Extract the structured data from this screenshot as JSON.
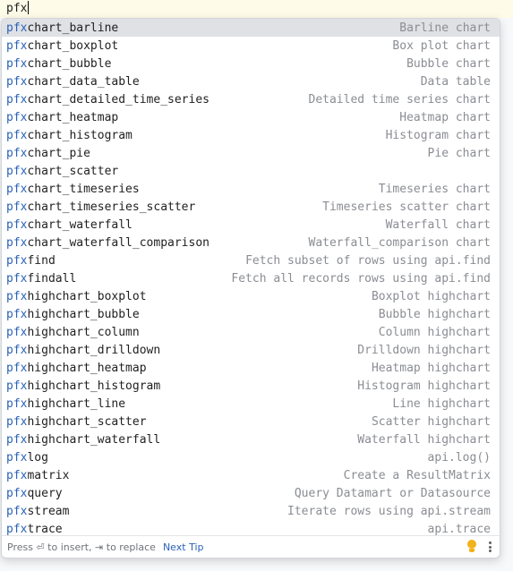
{
  "editor": {
    "typed_text": "pfx"
  },
  "completion": {
    "prefix": "pfx",
    "items": [
      {
        "name": "chart_barline",
        "desc": "Barline chart"
      },
      {
        "name": "chart_boxplot",
        "desc": "Box plot chart"
      },
      {
        "name": "chart_bubble",
        "desc": "Bubble chart"
      },
      {
        "name": "chart_data_table",
        "desc": "Data table"
      },
      {
        "name": "chart_detailed_time_series",
        "desc": "Detailed time series chart"
      },
      {
        "name": "chart_heatmap",
        "desc": "Heatmap chart"
      },
      {
        "name": "chart_histogram",
        "desc": "Histogram chart"
      },
      {
        "name": "chart_pie",
        "desc": "Pie chart"
      },
      {
        "name": "chart_scatter",
        "desc": ""
      },
      {
        "name": "chart_timeseries",
        "desc": "Timeseries chart"
      },
      {
        "name": "chart_timeseries_scatter",
        "desc": "Timeseries scatter chart"
      },
      {
        "name": "chart_waterfall",
        "desc": "Waterfall chart"
      },
      {
        "name": "chart_waterfall_comparison",
        "desc": "Waterfall_comparison chart"
      },
      {
        "name": "find",
        "desc": "Fetch subset of rows using api.find"
      },
      {
        "name": "findall",
        "desc": "Fetch all records rows using api.find"
      },
      {
        "name": "highchart_boxplot",
        "desc": "Boxplot highchart"
      },
      {
        "name": "highchart_bubble",
        "desc": "Bubble highchart"
      },
      {
        "name": "highchart_column",
        "desc": "Column highchart"
      },
      {
        "name": "highchart_drilldown",
        "desc": "Drilldown highchart"
      },
      {
        "name": "highchart_heatmap",
        "desc": "Heatmap highchart"
      },
      {
        "name": "highchart_histogram",
        "desc": "Histogram highchart"
      },
      {
        "name": "highchart_line",
        "desc": "Line highchart"
      },
      {
        "name": "highchart_scatter",
        "desc": "Scatter highchart"
      },
      {
        "name": "highchart_waterfall",
        "desc": "Waterfall highchart"
      },
      {
        "name": "log",
        "desc": "api.log()"
      },
      {
        "name": "matrix",
        "desc": "Create a ResultMatrix"
      },
      {
        "name": "query",
        "desc": "Query Datamart or Datasource"
      },
      {
        "name": "stream",
        "desc": "Iterate rows using api.stream"
      },
      {
        "name": "trace",
        "desc": "api.trace"
      }
    ],
    "selected_index": 0
  },
  "footer": {
    "hint": "Press ⏎ to insert, ⇥ to replace",
    "next_tip": "Next Tip",
    "bulb_icon": "lightbulb-icon",
    "menu_icon": "more-vertical-icon"
  },
  "colors": {
    "prefix_match": "#2a62b7",
    "selection": "#dfe1e5",
    "bulb": "#f2b21b"
  }
}
